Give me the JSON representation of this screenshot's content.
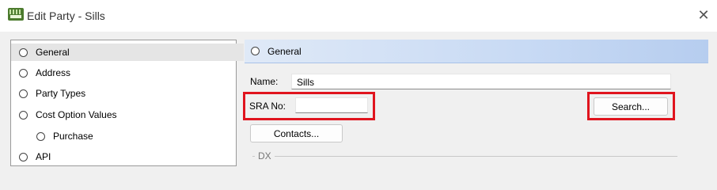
{
  "window": {
    "title": "Edit Party - Sills",
    "close_symbol": "✕"
  },
  "nav": {
    "items": [
      {
        "label": "General",
        "selected": true
      },
      {
        "label": "Address",
        "selected": false
      },
      {
        "label": "Party Types",
        "selected": false
      },
      {
        "label": "Cost Option Values",
        "selected": false
      },
      {
        "label": "Purchase",
        "selected": false
      },
      {
        "label": "API",
        "selected": false
      }
    ]
  },
  "section": {
    "title": "General"
  },
  "form": {
    "name_label": "Name:",
    "name_value": "Sills",
    "sra_label": "SRA No:",
    "sra_value": "",
    "search_label": "Search...",
    "contacts_label": "Contacts...",
    "group_label": "DX"
  },
  "colors": {
    "highlight": "#e0141e",
    "header_gradient_start": "#dfe9f7",
    "header_gradient_end": "#b6cdef"
  }
}
